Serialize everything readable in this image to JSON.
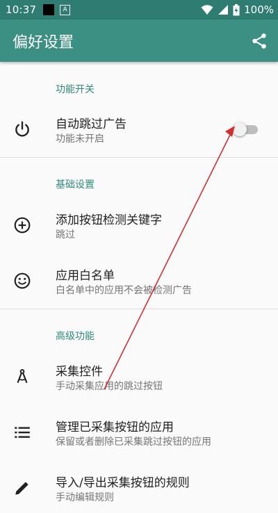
{
  "status_bar": {
    "time": "10:37",
    "notification_badge": "A",
    "battery_percent": "100%",
    "icons": [
      "wifi-icon",
      "signal-icon",
      "battery-icon"
    ]
  },
  "app_bar": {
    "title": "偏好设置",
    "action_icon": "share-icon",
    "color": "#3b8f83"
  },
  "sections": [
    {
      "header": "功能开关",
      "items": [
        {
          "title": "自动跳过广告",
          "summary": "功能未开启",
          "icon": "power-icon",
          "switch_on": false
        }
      ]
    },
    {
      "header": "基础设置",
      "items": [
        {
          "title": "添加按钮检测关键字",
          "summary": "跳过",
          "icon": "add-circle-icon"
        },
        {
          "title": "应用白名单",
          "summary": "白名单中的应用不会被检测广告",
          "icon": "smiley-icon"
        }
      ]
    },
    {
      "header": "高级功能",
      "items": [
        {
          "title": "采集控件",
          "summary": "手动采集应用的跳过按钮",
          "icon": "compass-icon"
        },
        {
          "title": "管理已采集按钮的应用",
          "summary": "保留或者删除已采集跳过按钮的应用",
          "icon": "list-icon"
        },
        {
          "title": "导入/导出采集按钮的规则",
          "summary": "手动编辑规则",
          "icon": "pencil-icon"
        }
      ]
    }
  ],
  "colors": {
    "accent": "#2f8a7e",
    "status_bar": "#2f7d72",
    "annotation_arrow": "#d32f2f"
  }
}
